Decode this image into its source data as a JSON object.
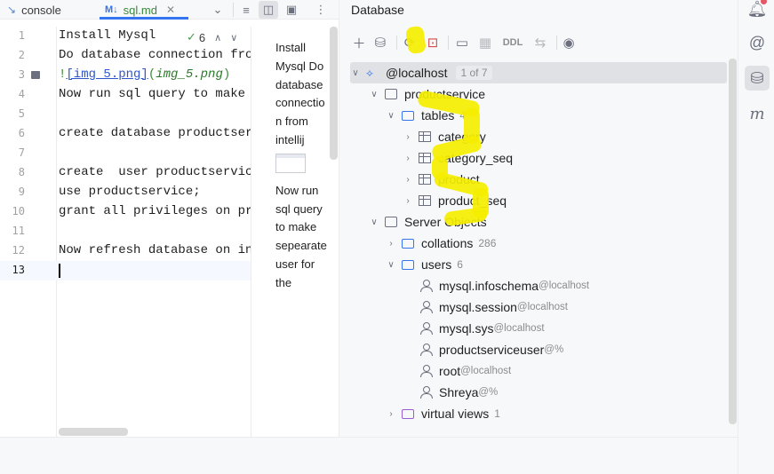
{
  "editor_tabs": {
    "console_label": "console",
    "file_badge": "M↓",
    "file_label": "sql.md"
  },
  "editor": {
    "inspection_count": "6",
    "lines": [
      {
        "num": "1",
        "text": "Install Mysql"
      },
      {
        "num": "2",
        "text": "Do database connection from intellij"
      },
      {
        "num": "3",
        "link_text": "[img_5.png]",
        "link_target": "img_5.png"
      },
      {
        "num": "4",
        "text": "Now run sql query to make sepearate user"
      },
      {
        "num": "5",
        "text": ""
      },
      {
        "num": "6",
        "text": "create database productservice;"
      },
      {
        "num": "7",
        "text": ""
      },
      {
        "num": "8",
        "text": "create  user productserviceuser"
      },
      {
        "num": "9",
        "text": "use productservice;"
      },
      {
        "num": "10",
        "text": "grant all privileges on productservice"
      },
      {
        "num": "11",
        "text": ""
      },
      {
        "num": "12",
        "text": "Now refresh database on intellij"
      },
      {
        "num": "13",
        "text": ""
      }
    ]
  },
  "preview": {
    "para1": "Install Mysql Do database connection from intellij",
    "para2": "Now run sql query to make sepearate user for the"
  },
  "database": {
    "title": "Database",
    "ddl_label": "DDL",
    "tree": {
      "root_label": "@localhost",
      "root_pager": "1 of 7",
      "schema_label": "productservice",
      "tables_label": "tables",
      "tables_count": "4",
      "tables": [
        "category",
        "category_seq",
        "product",
        "product_seq"
      ],
      "server_objects_label": "Server Objects",
      "collations_label": "collations",
      "collations_count": "286",
      "users_label": "users",
      "users_count": "6",
      "users": [
        {
          "name": "mysql.infoschema",
          "host": "@localhost"
        },
        {
          "name": "mysql.session",
          "host": "@localhost"
        },
        {
          "name": "mysql.sys",
          "host": "@localhost"
        },
        {
          "name": "productserviceuser",
          "host": "@%"
        },
        {
          "name": "root",
          "host": "@localhost"
        },
        {
          "name": "Shreya",
          "host": "@%"
        }
      ],
      "virtual_views_label": "virtual views",
      "virtual_views_count": "1"
    }
  },
  "colors": {
    "accent": "#3574f0",
    "highlight": "#f5ee00",
    "selection": "#dfe1e5",
    "notification": "#e55765"
  }
}
